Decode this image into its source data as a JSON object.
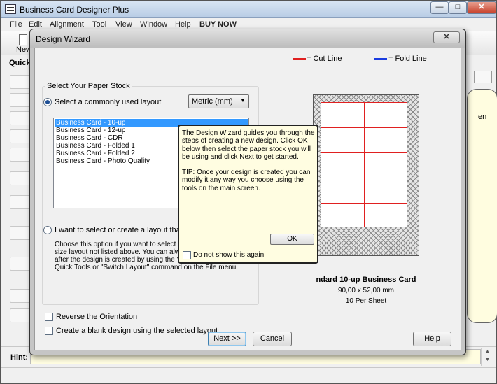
{
  "app": {
    "title": "Business Card Designer Plus",
    "window_controls": {
      "minimize": "—",
      "maximize": "□",
      "close": "✕"
    }
  },
  "menu": {
    "file": "File",
    "edit": "Edit",
    "alignment": "Alignment",
    "tool": "Tool",
    "view": "View",
    "window": "Window",
    "help": "Help",
    "buy_now": "BUY NOW"
  },
  "toolbar": {
    "new_label": "New"
  },
  "quick_label": "Quick",
  "right_panel_text": "en",
  "hint": {
    "label": "Hint:"
  },
  "dialog": {
    "title": "Design Wizard",
    "close": "✕",
    "legend": {
      "cut_line": "= Cut Line",
      "fold_line": "= Fold Line",
      "cut_color": "#e02020",
      "fold_color": "#1a3ce0"
    },
    "paper_stock_group": "Select Your Paper Stock",
    "option_common": "Select a commonly used layout",
    "option_custom": "I want to select or create a layout that match",
    "units_select": "Metric (mm)",
    "layouts": [
      "Business Card - 10-up",
      "Business Card - 12-up",
      "Business Card - CDR",
      "Business Card - Folded 1",
      "Business Card - Folded 2",
      "Business Card - Photo Quality"
    ],
    "selected_layout_index": 0,
    "custom_description": [
      "Choose this option if you want to select or c",
      "size layout not listed above. You can alway",
      "after the design is created by using the \"Ch",
      "Quick Tools or \"Switch Layout\" command on the File menu."
    ],
    "reverse_orientation": "Reverse the Orientation",
    "blank_design": "Create a blank design using the selected layout",
    "preview": {
      "title": "ndard 10-up Business Card",
      "dimensions": "90,00 x 52,00 mm",
      "count": "10 Per Sheet"
    },
    "buttons": {
      "next": "Next >>",
      "cancel": "Cancel",
      "help": "Help"
    }
  },
  "tip": {
    "paragraph1": "The Design Wizard guides you through the steps of creating a new design. Click OK below then select the paper stock you will be using and click Next to get started.",
    "paragraph2": "TIP: Once your design is created you can modify it any way you choose using the tools on the main screen.",
    "ok": "OK",
    "dont_show": "Do not show this again"
  }
}
